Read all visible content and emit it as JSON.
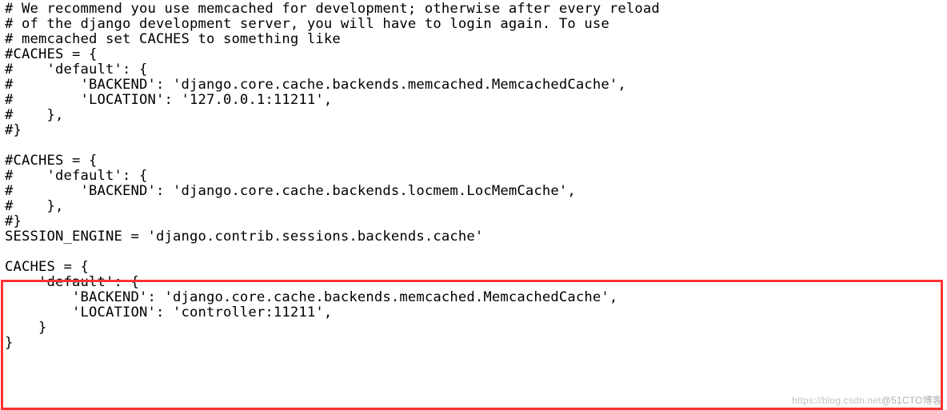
{
  "code": {
    "lines": [
      "# We recommend you use memcached for development; otherwise after every reload",
      "# of the django development server, you will have to login again. To use",
      "# memcached set CACHES to something like",
      "#CACHES = {",
      "#    'default': {",
      "#        'BACKEND': 'django.core.cache.backends.memcached.MemcachedCache',",
      "#        'LOCATION': '127.0.0.1:11211',",
      "#    },",
      "#}",
      "",
      "#CACHES = {",
      "#    'default': {",
      "#        'BACKEND': 'django.core.cache.backends.locmem.LocMemCache',",
      "#    },",
      "#}",
      "SESSION_ENGINE = 'django.contrib.sessions.backends.cache'",
      "",
      "CACHES = {",
      "    'default': {",
      "        'BACKEND': 'django.core.cache.backends.memcached.MemcachedCache',",
      "        'LOCATION': 'controller:11211',",
      "    }",
      "}"
    ]
  },
  "highlight": {
    "color": "#ff3333",
    "start_line_index": 15,
    "end_line_index": 22
  },
  "watermark": {
    "left": "https://blog.csdn.net",
    "right": "@51CTO博客"
  }
}
